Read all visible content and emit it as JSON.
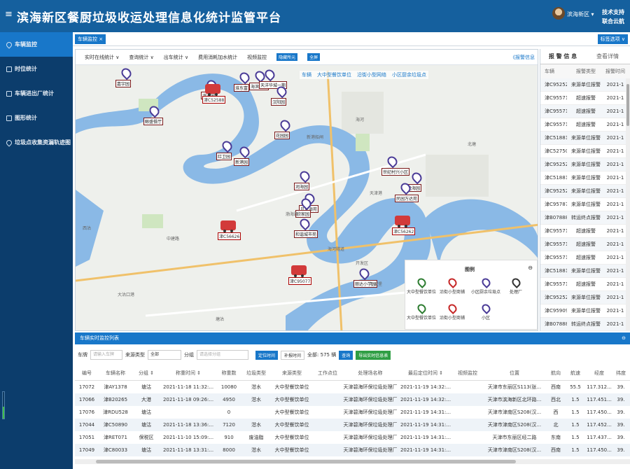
{
  "header": {
    "menu_icon": "≡",
    "title": "滨海新区餐厨垃圾收运处理信息化统计监管平台",
    "user": "滨海新区 ▾",
    "links": [
      "技术支持",
      "联合云航"
    ]
  },
  "sidebar": {
    "items": [
      {
        "label": "车辆监控",
        "icon": "pin"
      },
      {
        "label": "时位统计",
        "icon": "grid"
      },
      {
        "label": "车辆进出厂统计",
        "icon": "grid"
      },
      {
        "label": "图形统计",
        "icon": "chart"
      },
      {
        "label": "垃圾点收集资漏轨迹图",
        "icon": "route"
      }
    ],
    "level": 0.45
  },
  "tabbar": {
    "tab": "车辆监控 ×",
    "select": "标签选项 ∨"
  },
  "maptool": {
    "items": [
      "实时在线统计 ∨",
      "查询统计 ∨",
      "出车统计 ∨",
      "费用消耗加水统计",
      "视频监控"
    ],
    "btn1": "隐藏所元",
    "btn2": "全屏",
    "right": "《报警信息"
  },
  "maplayers": [
    "车辆",
    "大中型餐饮单位",
    "沿街小型网络",
    "小区厨余垃圾点"
  ],
  "markers": [
    {
      "label": "嘉宇园"
    },
    {
      "label": "淮东富"
    },
    {
      "label": "海滨东路"
    },
    {
      "label": "天洋华城一期"
    },
    {
      "label": "汉阳园"
    },
    {
      "label": "滨海园"
    },
    {
      "label": "鲸盛餐厅"
    },
    {
      "label": "红卫园"
    },
    {
      "label": "新港园"
    },
    {
      "label": "花园园"
    },
    {
      "label": "世纪村兴小区"
    },
    {
      "label": "悦海园"
    },
    {
      "label": "润海园"
    },
    {
      "label": "贝克海苑"
    },
    {
      "label": "和谐城市苑"
    },
    {
      "label": "丽达小学园"
    },
    {
      "label": "民园万达苑"
    },
    {
      "label": "欣家园"
    }
  ],
  "trucks": [
    {
      "label": "津C52588"
    },
    {
      "label": "津C56626"
    },
    {
      "label": "津C95077"
    },
    {
      "label": "津C56262"
    }
  ],
  "maptexts": [
    "大沽口港",
    "新港船闸",
    "天津港",
    "海河隧道",
    "中建路",
    "北塘",
    "渤海路",
    "开发区",
    "西沽",
    "于家堡",
    "海河",
    "塘沽"
  ],
  "legend": {
    "title": "图例",
    "items": [
      "大中型餐饮单位",
      "沿街小型商铺",
      "小区厨余垃圾点",
      "处理厂",
      "大中型餐饮单位",
      "沿街小型商铺",
      "小区"
    ]
  },
  "rightpanel": {
    "title": "报 警 信 息",
    "more": "查看详情",
    "cols": [
      "车辆",
      "报警类型",
      "报警时间"
    ],
    "rows": [
      [
        "津C95252",
        "来源单位报警",
        "2021-1"
      ],
      [
        "津C95571",
        "超速报警",
        "2021-1"
      ],
      [
        "津C95571",
        "超速报警",
        "2021-1"
      ],
      [
        "津C95571",
        "超速报警",
        "2021-1"
      ],
      [
        "津C51881",
        "来源单位报警",
        "2021-1"
      ],
      [
        "津C52750",
        "来源单位报警",
        "2021-1"
      ],
      [
        "津C95252",
        "来源单位报警",
        "2021-1"
      ],
      [
        "津C51881",
        "来源单位报警",
        "2021-1"
      ],
      [
        "津C95252",
        "来源单位报警",
        "2021-1"
      ],
      [
        "津C95787",
        "来源单位报警",
        "2021-1"
      ],
      [
        "津B07888",
        "转运终点报警",
        "2021-1"
      ],
      [
        "津C95571",
        "超速报警",
        "2021-1"
      ],
      [
        "津C95571",
        "超速报警",
        "2021-1"
      ],
      [
        "津C95571",
        "超速报警",
        "2021-1"
      ],
      [
        "津C51881",
        "来源单位报警",
        "2021-1"
      ],
      [
        "津C95571",
        "超速报警",
        "2021-1"
      ],
      [
        "津C95252",
        "来源单位报警",
        "2021-1"
      ],
      [
        "津C95909",
        "来源单位报警",
        "2021-1"
      ],
      [
        "津B07888",
        "转运终点报警",
        "2021-1"
      ]
    ]
  },
  "listbar": {
    "title": "车辆实时监控列表",
    "close": "⊖"
  },
  "filter": {
    "car_label": "车牌",
    "car_ph": "请输入车牌",
    "src_label": "来源类型",
    "src_val": "全部",
    "grp_label": "分组",
    "grp_ph": "请选择分组",
    "b1": "定位时间",
    "b2": "补报时间",
    "total": "全部: 575 辆",
    "b3": "查询",
    "b4": "导出实时信息表"
  },
  "grid": {
    "cols": [
      "编号",
      "车辆名称",
      "分组 ⇕",
      "称重时间 ⇕",
      "称重数",
      "垃圾类型",
      "来源类型",
      "工作点位",
      "处理场名称",
      "最后定位时间 ⇕",
      "视频监控",
      "位置",
      "航向",
      "航速",
      "经度",
      "纬度"
    ],
    "rows": [
      [
        "17072",
        "津AY1378",
        "塘沽",
        "2021-11-18 11:32:...",
        "10080",
        "泔水",
        "大中型餐饮单位",
        "",
        "天津碧海环保垃圾处理厂",
        "2021-11-19 14:32:...",
        "",
        "天津市东丽区S113(张...",
        "西南",
        "55.5",
        "117.312...",
        "39."
      ],
      [
        "17066",
        "津B20265",
        "大港",
        "2021-11-18 09:26:...",
        "4950",
        "泔水",
        "大中型餐饮单位",
        "",
        "天津碧海环保垃圾处理厂",
        "2021-11-19 14:32:...",
        "",
        "天津市滨海新区北环路...",
        "西北",
        "1.5",
        "117.451...",
        "39."
      ],
      [
        "17076",
        "津RDU528",
        "塘沽",
        "",
        "0",
        "",
        "大中型餐饮单位",
        "",
        "天津碧海环保垃圾处理厂",
        "2021-11-19 14:31:...",
        "",
        "天津市津南区S208(汉...",
        "西",
        "1.5",
        "117.450...",
        "39."
      ],
      [
        "17044",
        "津C50890",
        "塘沽",
        "2021-11-18 13:36:...",
        "7120",
        "泔水",
        "大中型餐饮单位",
        "",
        "天津碧海环保垃圾处理厂",
        "2021-11-19 14:31:...",
        "",
        "天津市津南区S208(汉...",
        "北",
        "1.5",
        "117.452...",
        "39."
      ],
      [
        "17051",
        "津RET071",
        "保税区",
        "2021-11-10 15:09:...",
        "910",
        "废油脂",
        "大中型餐饮单位",
        "",
        "天津碧海环保垃圾处理厂",
        "2021-11-19 14:31:...",
        "",
        "天津市东丽区经二路",
        "东南",
        "1.5",
        "117.437...",
        "39."
      ],
      [
        "17049",
        "津C80033",
        "塘沽",
        "2021-11-18 13:31:...",
        "8000",
        "泔水",
        "大中型餐饮单位",
        "",
        "天津碧海环保垃圾处理厂",
        "2021-11-19 14:31:...",
        "",
        "天津市津南区S208(汉...",
        "西南",
        "1.5",
        "117.450...",
        "39."
      ]
    ]
  }
}
